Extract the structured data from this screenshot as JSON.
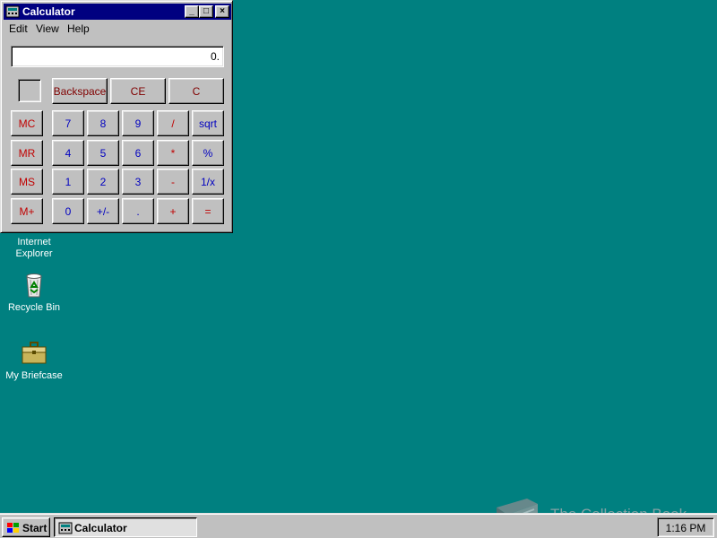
{
  "desktop": {
    "background": "#008080",
    "icons": [
      {
        "label_line1": "Internet",
        "label_line2": "Explorer",
        "icon": "internet-explorer-icon"
      },
      {
        "label": "Recycle Bin",
        "icon": "recycle-bin-icon"
      },
      {
        "label": "My Briefcase",
        "icon": "briefcase-icon"
      }
    ]
  },
  "window": {
    "title": "Calculator",
    "title_color": "#000080",
    "controls": {
      "minimize": "_",
      "maximize": "□",
      "close": "×"
    },
    "menu": [
      {
        "label": "Edit"
      },
      {
        "label": "View"
      },
      {
        "label": "Help"
      }
    ],
    "display_value": "0.",
    "buttons": {
      "backspace": "Backspace",
      "ce": "CE",
      "c": "C",
      "mc": "MC",
      "mr": "MR",
      "ms": "MS",
      "mplus": "M+",
      "n7": "7",
      "n8": "8",
      "n9": "9",
      "div": "/",
      "sqrt": "sqrt",
      "n4": "4",
      "n5": "5",
      "n6": "6",
      "mul": "*",
      "pct": "%",
      "n1": "1",
      "n2": "2",
      "n3": "3",
      "sub": "-",
      "recip": "1/x",
      "n0": "0",
      "sign": "+/-",
      "dot": ".",
      "add": "+",
      "eq": "="
    }
  },
  "taskbar": {
    "start_label": "Start",
    "task_label": "Calculator",
    "clock": "1:16 PM"
  },
  "watermark": {
    "text": "The Collection Book"
  },
  "colors": {
    "red": "#c00000",
    "blue": "#0000c0",
    "face": "#c0c0c0"
  }
}
